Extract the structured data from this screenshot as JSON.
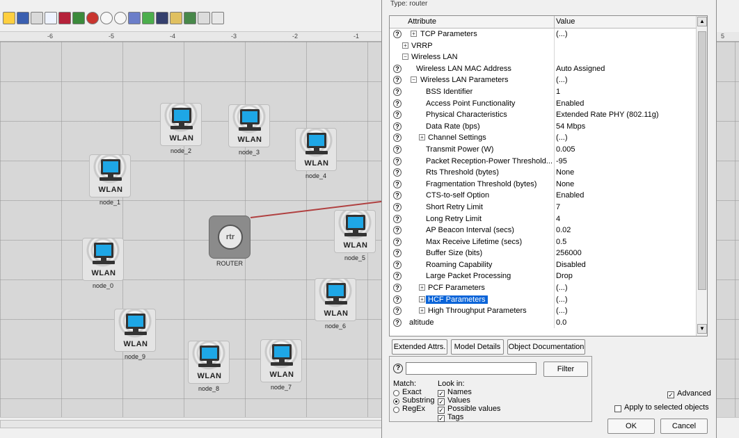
{
  "ruler": {
    "ticks": [
      "-6",
      "-5",
      "-4",
      "-3",
      "-2",
      "-1",
      "5"
    ]
  },
  "topology": {
    "router": {
      "badge": "rtr",
      "label": "ROUTER"
    },
    "nodes": [
      {
        "badge": "WLAN",
        "label": "node_2"
      },
      {
        "badge": "WLAN",
        "label": "node_3"
      },
      {
        "badge": "WLAN",
        "label": "node_4"
      },
      {
        "badge": "WLAN",
        "label": "node_1"
      },
      {
        "badge": "WLAN",
        "label": "node_5"
      },
      {
        "badge": "WLAN",
        "label": "node_0"
      },
      {
        "badge": "WLAN",
        "label": "node_6"
      },
      {
        "badge": "WLAN",
        "label": "node_9"
      },
      {
        "badge": "WLAN",
        "label": "node_8"
      },
      {
        "badge": "WLAN",
        "label": "node_7"
      }
    ]
  },
  "dialog": {
    "type_text": "Type: router",
    "columns": {
      "attribute": "Attribute",
      "value": "Value"
    },
    "rows": [
      {
        "attr": "TCP Parameters",
        "value": "(...)"
      },
      {
        "attr": "VRRP",
        "value": ""
      },
      {
        "attr": "Wireless LAN",
        "value": ""
      },
      {
        "attr": "Wireless LAN MAC Address",
        "value": "Auto Assigned"
      },
      {
        "attr": "Wireless LAN Parameters",
        "value": "(...)"
      },
      {
        "attr": "BSS Identifier",
        "value": "1"
      },
      {
        "attr": "Access Point Functionality",
        "value": "Enabled"
      },
      {
        "attr": "Physical Characteristics",
        "value": "Extended Rate PHY (802.11g)"
      },
      {
        "attr": "Data Rate (bps)",
        "value": "54 Mbps"
      },
      {
        "attr": "Channel Settings",
        "value": "(...)"
      },
      {
        "attr": "Transmit Power (W)",
        "value": "0.005"
      },
      {
        "attr": "Packet Reception-Power Threshold...",
        "value": "-95"
      },
      {
        "attr": "Rts Threshold (bytes)",
        "value": "None"
      },
      {
        "attr": "Fragmentation Threshold (bytes)",
        "value": "None"
      },
      {
        "attr": "CTS-to-self Option",
        "value": "Enabled"
      },
      {
        "attr": "Short Retry Limit",
        "value": "7"
      },
      {
        "attr": "Long Retry Limit",
        "value": "4"
      },
      {
        "attr": "AP Beacon Interval (secs)",
        "value": "0.02"
      },
      {
        "attr": "Max Receive Lifetime (secs)",
        "value": "0.5"
      },
      {
        "attr": "Buffer Size (bits)",
        "value": "256000"
      },
      {
        "attr": "Roaming Capability",
        "value": "Disabled"
      },
      {
        "attr": "Large Packet Processing",
        "value": "Drop"
      },
      {
        "attr": "PCF Parameters",
        "value": "(...)"
      },
      {
        "attr": "HCF Parameters",
        "value": "(...)"
      },
      {
        "attr": "High Throughput Parameters",
        "value": "(...)"
      },
      {
        "attr": "altitude",
        "value": "0.0"
      }
    ],
    "buttons": {
      "extended": "Extended Attrs.",
      "model": "Model Details",
      "object_doc": "Object Documentation",
      "filter": "Filter",
      "ok": "OK",
      "cancel": "Cancel"
    },
    "search": {
      "value": ""
    },
    "match": {
      "label": "Match:",
      "exact": "Exact",
      "substring": "Substring",
      "regex": "RegEx"
    },
    "look_in": {
      "label": "Look in:",
      "names": "Names",
      "values": "Values",
      "possible": "Possible values",
      "tags": "Tags"
    },
    "advanced": "Advanced",
    "apply_selected": "Apply to selected objects"
  }
}
